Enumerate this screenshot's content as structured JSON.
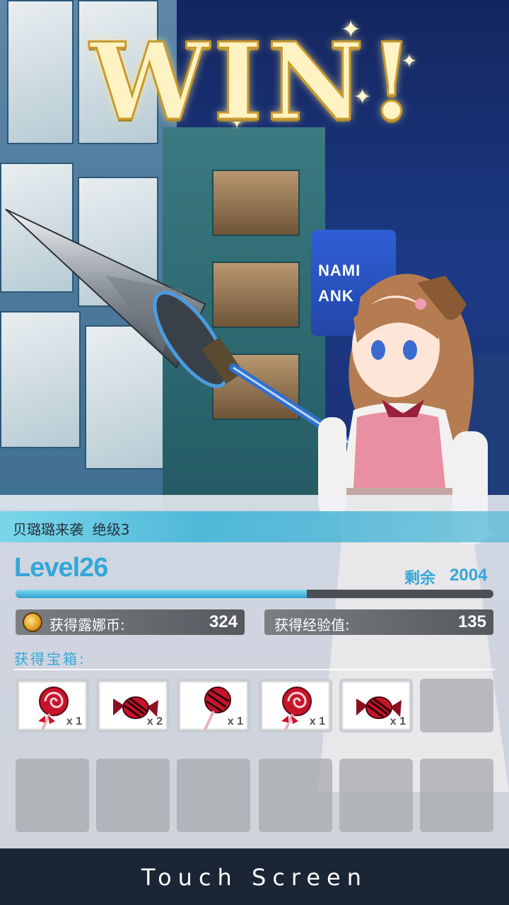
{
  "title": "WIN!",
  "background_sign": "NAMI\nANK",
  "stage": {
    "name": "贝璐璐来袭  绝级3"
  },
  "level": {
    "label": "Level26",
    "remain_label": "剩余",
    "remain_value": "2004",
    "progress_fraction": 0.61
  },
  "rewards": {
    "coins_label": "获得露娜币:",
    "coins_value": "324",
    "exp_label": "获得经验值:",
    "exp_value": "135"
  },
  "chest": {
    "label": "获得宝箱:",
    "items": [
      {
        "icon": "swirl-lollipop-icon",
        "qty": "x 1"
      },
      {
        "icon": "wrapped-candy-icon",
        "qty": "x 2"
      },
      {
        "icon": "lollipop-icon",
        "qty": "x 1"
      },
      {
        "icon": "swirl-lollipop-icon",
        "qty": "x 1"
      },
      {
        "icon": "wrapped-candy-icon",
        "qty": "x 1"
      }
    ]
  },
  "footer": {
    "prompt": "Touch Screen"
  },
  "colors": {
    "accent": "#33a7d8",
    "gold": "#c99a2d"
  }
}
